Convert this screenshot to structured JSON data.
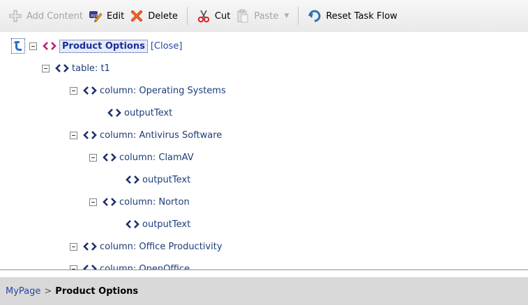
{
  "toolbar": {
    "add_content": "Add Content",
    "edit": "Edit",
    "delete": "Delete",
    "cut": "Cut",
    "paste": "Paste",
    "reset_task_flow": "Reset Task Flow"
  },
  "tree": {
    "root": {
      "label": "Product Options",
      "close_label": "[Close]"
    },
    "nodes": [
      {
        "label": "table: t1"
      },
      {
        "label": "column: Operating Systems"
      },
      {
        "label": "outputText"
      },
      {
        "label": "column: Antivirus Software"
      },
      {
        "label": "column: ClamAV"
      },
      {
        "label": "outputText"
      },
      {
        "label": "column: Norton"
      },
      {
        "label": "outputText"
      },
      {
        "label": "column: Office Productivity"
      },
      {
        "label": "column: OpenOffice"
      }
    ]
  },
  "breadcrumb": {
    "parent": "MyPage",
    "separator": ">",
    "current": "Product Options"
  },
  "colors": {
    "tag_icon": "#1c2f6e",
    "root_tag_icon": "#c2187a",
    "link": "#2c46a3",
    "selection": "#e6ecf8"
  },
  "icons": {
    "add_content": "plus-icon",
    "edit": "marker-pen-icon",
    "delete": "x-icon",
    "cut": "scissors-icon",
    "paste": "clipboard-icon",
    "reset": "reset-arrow-icon",
    "up": "up-arrow-icon",
    "tag": "code-tag-icon"
  }
}
